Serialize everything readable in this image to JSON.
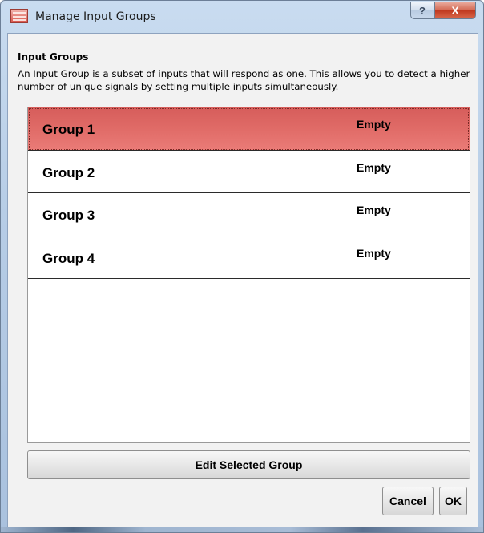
{
  "window": {
    "title": "Manage Input Groups",
    "help_glyph": "?",
    "close_glyph": "X"
  },
  "section": {
    "title": "Input Groups",
    "description": "An Input Group is a subset of inputs that will respond as one.  This allows you to detect a higher number of unique signals by setting multiple inputs simultaneously."
  },
  "groups": [
    {
      "name": "Group 1",
      "status": "Empty",
      "selected": true
    },
    {
      "name": "Group 2",
      "status": "Empty",
      "selected": false
    },
    {
      "name": "Group 3",
      "status": "Empty",
      "selected": false
    },
    {
      "name": "Group 4",
      "status": "Empty",
      "selected": false
    }
  ],
  "buttons": {
    "edit": "Edit Selected Group",
    "cancel": "Cancel",
    "ok": "OK"
  },
  "colors": {
    "selected_row": "#e06b67",
    "close_button": "#c0391f"
  },
  "icons": {
    "app": "app-logo-icon",
    "help": "help-icon",
    "close": "close-icon"
  }
}
